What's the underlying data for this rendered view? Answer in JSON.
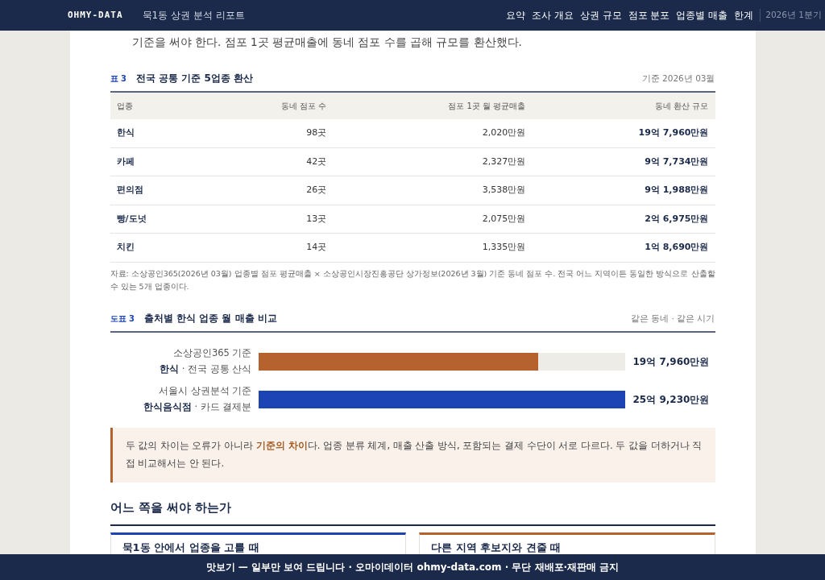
{
  "navbar": {
    "brand": "OHMY-DATA",
    "title": "묵1동 상권 분석 리포트",
    "links": [
      {
        "label": "요약"
      },
      {
        "label": "조사 개요"
      },
      {
        "label": "상권 규모"
      },
      {
        "label": "점포 분포"
      },
      {
        "label": "업종별 매출"
      },
      {
        "label": "한계"
      }
    ],
    "period": "2026년 1분기"
  },
  "intro": "기준을 써야 한다. 점포 1곳 평균매출에 동네 점포 수를 곱해 규모를 환산했다.",
  "table": {
    "tag": "표 3",
    "title": "전국 공통 기준 5업종 환산",
    "note": "기준 2026년 03월",
    "columns": [
      "업종",
      "동네 점포 수",
      "점포 1곳 월 평균매출",
      "동네 환산 규모"
    ],
    "rows": [
      [
        "한식",
        "98곳",
        "2,020만원",
        "19억 7,960만원"
      ],
      [
        "카페",
        "42곳",
        "2,327만원",
        "9억 7,734만원"
      ],
      [
        "편의점",
        "26곳",
        "3,538만원",
        "9억 1,988만원"
      ],
      [
        "빵/도넛",
        "13곳",
        "2,075만원",
        "2억 6,975만원"
      ],
      [
        "치킨",
        "14곳",
        "1,335만원",
        "1억 8,690만원"
      ]
    ],
    "source": "자료: 소상공인365(2026년 03월) 업종별 점포 평균매출 × 소상공인시장진흥공단 상가정보(2026년 3월) 기준 동네 점포 수. 전국 어느 지역이든 동일한 방식으로 산출할 수 있는 5개 업종이다."
  },
  "figure": {
    "tag": "도표 3",
    "title": "출처별 한식 업종 월 매출 비교",
    "note": "같은 동네 · 같은 시기",
    "bars": [
      {
        "source": "소상공인365 기준",
        "label": "**한식** · 전국 공통 산식",
        "level": 0.764,
        "color": "#b5622f",
        "value": "19억 7,960만원"
      },
      {
        "source": "서울시 상권분석 기준",
        "label": "**한식음식점** · 카드 결제분",
        "level": 1.0,
        "color": "#1c44b5",
        "value": "25억 9,230만원"
      }
    ]
  },
  "callout": "두 값의 차이는 오류가 아니라 **기준의 차이**다. 업종 분류 체계, 매출 산출 방식, 포함되는 결제 수단이 서로 다르다. 두 값을 더하거나 직접 비교해서는 안 된다.",
  "section": {
    "heading": "어느 쪽을 써야 하는가",
    "cards": [
      {
        "title": "묵1동 안에서 업종을 고를 때",
        "color": "#1c44b5"
      },
      {
        "title": "다른 지역 후보지와 견줄 때",
        "color": "#b5622f"
      }
    ]
  },
  "footer_banner": "맛보기 — 일부만 보여 드립니다 · 오마이데이터 ohmy-data.com · 무단 재배포·재판매 금지"
}
